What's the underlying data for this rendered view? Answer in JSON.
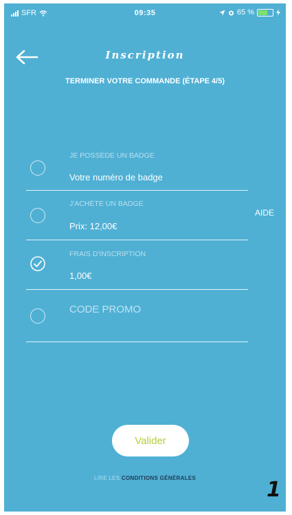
{
  "status_bar": {
    "carrier": "SFR",
    "time": "09:35",
    "battery": "65 %"
  },
  "header": {
    "title": "Inscription",
    "subtitle": "TERMINER VOTRE COMMANDE (ÉTAPE 4/5)"
  },
  "options": [
    {
      "caption": "JE POSSÈDE UN BADGE",
      "value": "Votre numéro de badge",
      "checked": false
    },
    {
      "caption": "J'ACHÈTE UN BADGE",
      "value": "Prix: 12,00€",
      "checked": false
    },
    {
      "caption": "FRAIS D'INSCRIPTION",
      "value": "1,00€",
      "checked": true
    }
  ],
  "help_link": "AIDE",
  "promo": {
    "placeholder": "CODE PROMO"
  },
  "submit": {
    "label": "Valider"
  },
  "terms": {
    "prefix": "LIRE LES",
    "link": "CONDITIONS GÉNÉRALES"
  },
  "page_number": "1",
  "colors": {
    "background": "#4fb0d4",
    "button_text": "#b5cf3a",
    "link": "#1f3b55"
  }
}
